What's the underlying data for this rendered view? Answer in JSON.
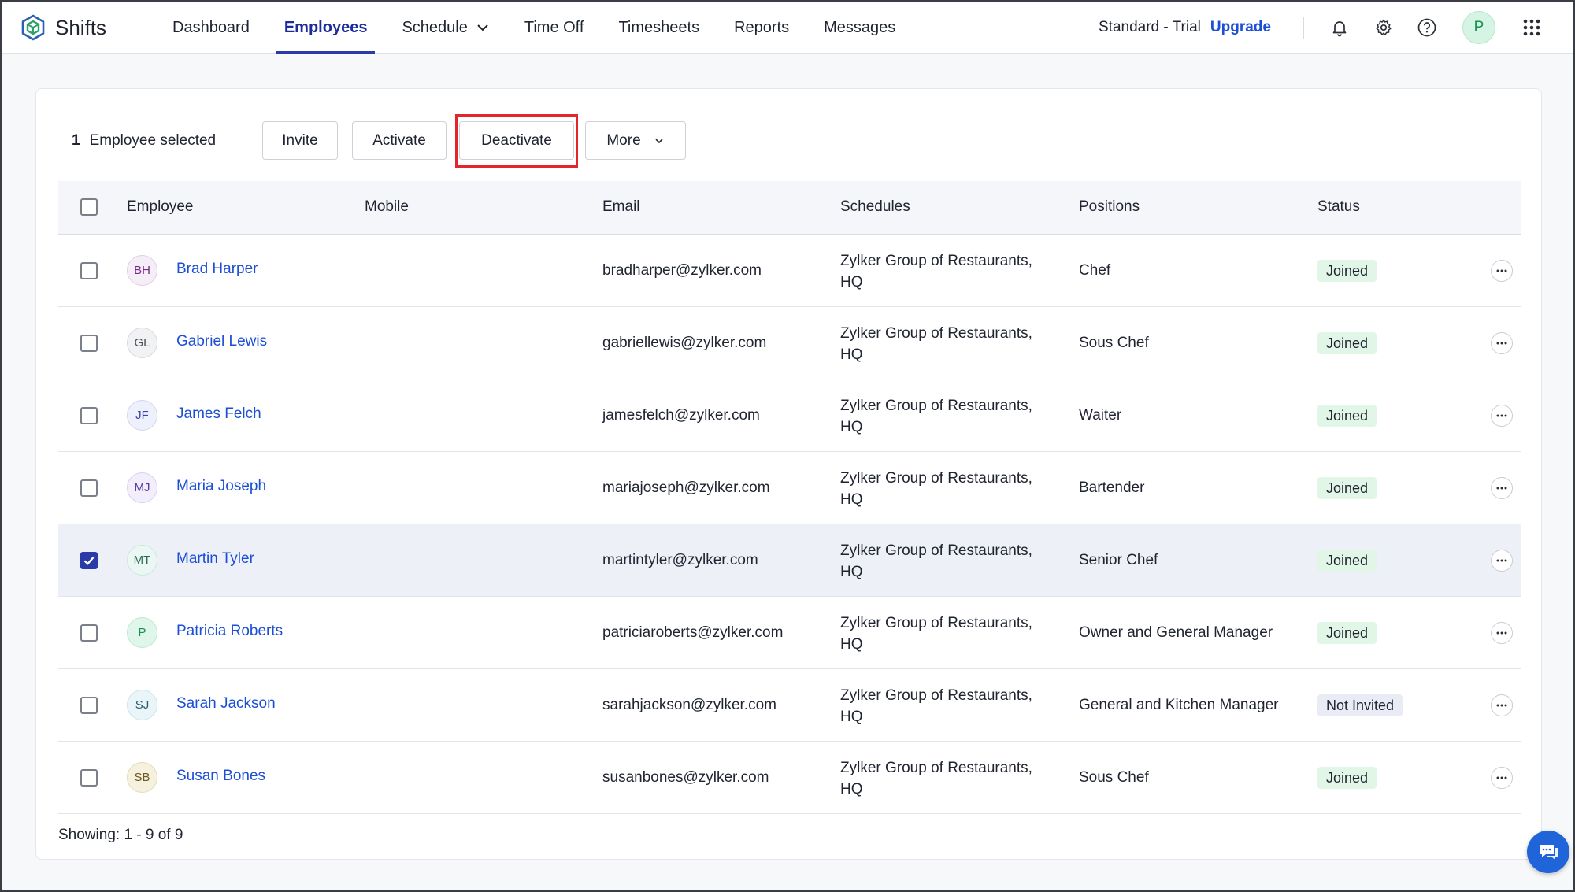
{
  "app": {
    "name": "Shifts"
  },
  "nav": {
    "items": [
      {
        "label": "Dashboard"
      },
      {
        "label": "Employees"
      },
      {
        "label": "Schedule"
      },
      {
        "label": "Time Off"
      },
      {
        "label": "Timesheets"
      },
      {
        "label": "Reports"
      },
      {
        "label": "Messages"
      }
    ],
    "active": "Employees"
  },
  "plan": {
    "label": "Standard - Trial",
    "upgrade": "Upgrade"
  },
  "user": {
    "initial": "P"
  },
  "toolbar": {
    "selected_count": "1",
    "selected_label": "Employee selected",
    "invite": "Invite",
    "activate": "Activate",
    "deactivate": "Deactivate",
    "more": "More"
  },
  "table": {
    "headers": {
      "employee": "Employee",
      "mobile": "Mobile",
      "email": "Email",
      "schedules": "Schedules",
      "positions": "Positions",
      "status": "Status"
    },
    "rows": [
      {
        "initials": "BH",
        "name": "Brad Harper",
        "email": "bradharper@zylker.com",
        "schedule_1": "Zylker Group of Restaurants,",
        "schedule_2": "HQ",
        "position": "Chef",
        "status": "Joined",
        "checked": false,
        "avatar_bg": "#f6eef7",
        "avatar_border": "#e2cde6",
        "avatar_fg": "#7a2a8a"
      },
      {
        "initials": "GL",
        "name": "Gabriel Lewis",
        "email": "gabriellewis@zylker.com",
        "schedule_1": "Zylker Group of Restaurants,",
        "schedule_2": "HQ",
        "position": "Sous Chef",
        "status": "Joined",
        "checked": false,
        "avatar_bg": "#f1f2f4",
        "avatar_border": "#d5d8dd",
        "avatar_fg": "#4a4f58"
      },
      {
        "initials": "JF",
        "name": "James Felch",
        "email": "jamesfelch@zylker.com",
        "schedule_1": "Zylker Group of Restaurants,",
        "schedule_2": "HQ",
        "position": "Waiter",
        "status": "Joined",
        "checked": false,
        "avatar_bg": "#eef0fb",
        "avatar_border": "#d1d6f0",
        "avatar_fg": "#3a45a8"
      },
      {
        "initials": "MJ",
        "name": "Maria Joseph",
        "email": "mariajoseph@zylker.com",
        "schedule_1": "Zylker Group of Restaurants,",
        "schedule_2": "HQ",
        "position": "Bartender",
        "status": "Joined",
        "checked": false,
        "avatar_bg": "#f3eefb",
        "avatar_border": "#dccff0",
        "avatar_fg": "#5a3aa8"
      },
      {
        "initials": "MT",
        "name": "Martin Tyler",
        "email": "martintyler@zylker.com",
        "schedule_1": "Zylker Group of Restaurants,",
        "schedule_2": "HQ",
        "position": "Senior Chef",
        "status": "Joined",
        "checked": true,
        "avatar_bg": "#eaf7f2",
        "avatar_border": "#c8e9db",
        "avatar_fg": "#2a6b55"
      },
      {
        "initials": "P",
        "name": "Patricia Roberts",
        "email": "patriciaroberts@zylker.com",
        "schedule_1": "Zylker Group of Restaurants,",
        "schedule_2": "HQ",
        "position": "Owner and General Manager",
        "status": "Joined",
        "checked": false,
        "avatar_bg": "#dff7ea",
        "avatar_border": "#bde8d0",
        "avatar_fg": "#15924f"
      },
      {
        "initials": "SJ",
        "name": "Sarah Jackson",
        "email": "sarahjackson@zylker.com",
        "schedule_1": "Zylker Group of Restaurants,",
        "schedule_2": "HQ",
        "position": "General and Kitchen Manager",
        "status": "Not Invited",
        "checked": false,
        "avatar_bg": "#eaf5f9",
        "avatar_border": "#cbe4ee",
        "avatar_fg": "#2a5f72"
      },
      {
        "initials": "SB",
        "name": "Susan Bones",
        "email": "susanbones@zylker.com",
        "schedule_1": "Zylker Group of Restaurants,",
        "schedule_2": "HQ",
        "position": "Sous Chef",
        "status": "Joined",
        "checked": false,
        "avatar_bg": "#f6f1de",
        "avatar_border": "#e4dbb8",
        "avatar_fg": "#6b5a1f"
      }
    ]
  },
  "footer": {
    "showing": "Showing: 1 - 9 of 9"
  },
  "colors": {
    "accent": "#2a3aa8",
    "link": "#1c4fd6",
    "highlight": "#e3262b",
    "joined_bg": "#e1f6e6"
  },
  "icons": [
    "shifts-logo-icon",
    "chevron-down-icon",
    "bell-icon",
    "gear-icon",
    "help-icon",
    "apps-grid-icon",
    "ellipsis-icon",
    "chat-icon",
    "check-icon"
  ]
}
